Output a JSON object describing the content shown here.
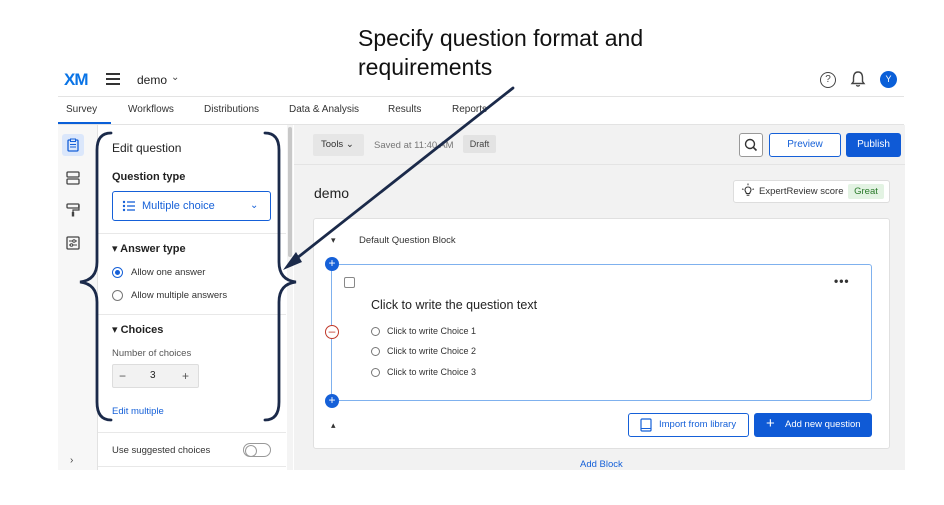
{
  "annotation": {
    "line1": "Specify question format and",
    "line2": "requirements"
  },
  "header": {
    "logo": "XM",
    "project": "demo",
    "avatar": "Y",
    "help": "?"
  },
  "tabs": [
    "Survey",
    "Workflows",
    "Distributions",
    "Data & Analysis",
    "Results",
    "Reports"
  ],
  "edit_panel": {
    "title": "Edit question",
    "question_type_label": "Question type",
    "question_type_value": "Multiple choice",
    "answer_type_label": "Answer type",
    "answer_options": [
      "Allow one answer",
      "Allow multiple answers"
    ],
    "choices_label": "Choices",
    "number_of_choices_label": "Number of choices",
    "stepper_minus": "−",
    "stepper_plus": "+",
    "number_of_choices": "3",
    "edit_multiple": "Edit multiple",
    "use_suggested": "Use suggested choices"
  },
  "toolbar": {
    "tools": "Tools",
    "saved": "Saved at 11:40 AM",
    "draft": "Draft",
    "preview": "Preview",
    "publish": "Publish"
  },
  "survey": {
    "title": "demo",
    "expert_review": "ExpertReview score",
    "expert_grade": "Great",
    "block_name": "Default Question Block",
    "more": "•••",
    "question_text": "Click to write the question text",
    "choices": [
      "Click to write Choice 1",
      "Click to write Choice 2",
      "Click to write Choice 3"
    ],
    "import_label": "Import from library",
    "add_question_label": "Add new question",
    "add_block_label": "Add Block"
  },
  "colors": {
    "accent": "#0f5ad6",
    "annotation": "#1b2a4a",
    "remove": "#c0392b"
  }
}
